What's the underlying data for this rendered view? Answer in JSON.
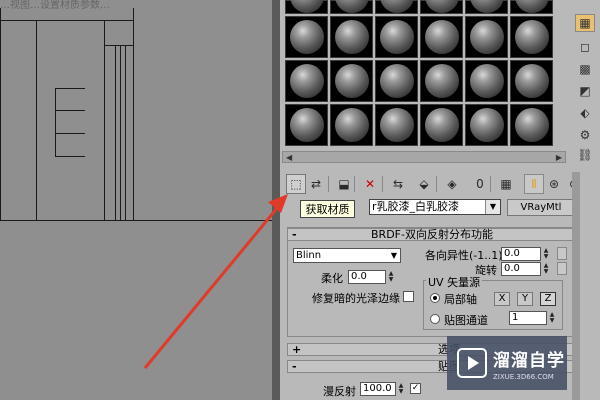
{
  "viewport": {
    "title_fragment": "…视图…设置材质参数…"
  },
  "material_editor": {
    "rows": 3,
    "cols": 6,
    "toolbar": {
      "buttons": [
        {
          "name": "get-material-button",
          "glyph": "⬚"
        },
        {
          "name": "put-to-scene-button",
          "glyph": "⇄"
        },
        {
          "name": "assign-to-selection-button",
          "glyph": "⬓"
        },
        {
          "name": "delete-button",
          "glyph": "✕"
        },
        {
          "name": "make-copy-button",
          "glyph": "⇆"
        },
        {
          "name": "make-unique-button",
          "glyph": "⬙"
        },
        {
          "name": "put-to-library-button",
          "glyph": "◈"
        },
        {
          "name": "material-id-button",
          "glyph": "0"
        },
        {
          "name": "show-map-button",
          "glyph": "▦"
        },
        {
          "name": "show-end-result-button",
          "glyph": "Ⅱ"
        },
        {
          "name": "go-to-parent-button",
          "glyph": "⊛"
        },
        {
          "name": "go-forward-button",
          "glyph": "⊛"
        }
      ]
    },
    "tooltip": "获取材质",
    "material_name": "r乳胶漆_白乳胶漆",
    "material_type_button": "VRayMtl"
  },
  "brdf": {
    "title": "BRDF-双向反射分布功能",
    "type": "Blinn",
    "soften_label": "柔化",
    "soften_value": "0.0",
    "anisotropy_label": "各向异性(-1..1)",
    "anisotropy_value": "0.0",
    "rotation_label": "旋转",
    "rotation_value": "0.0",
    "fix_dark_label": "修复暗的光泽边缘",
    "uv_group": "UV 矢量源",
    "local_axis_label": "局部轴",
    "map_channel_label": "贴图通道",
    "map_channel_value": "1",
    "axis_buttons": [
      "X",
      "Y",
      "Z"
    ]
  },
  "rollouts": {
    "options": "选项",
    "maps": "贴图",
    "diffuse_label": "漫反射",
    "diffuse_value": "100.0"
  },
  "watermark": {
    "brand": "溜溜自学",
    "url": "ZIXUE.3D66.COM"
  }
}
